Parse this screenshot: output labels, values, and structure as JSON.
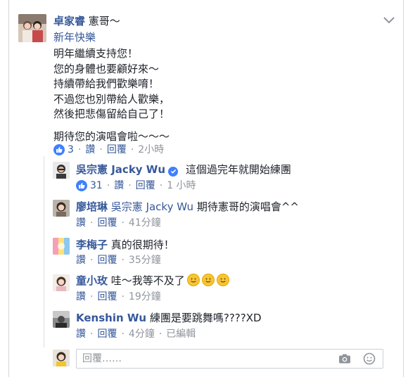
{
  "main_comment": {
    "author": "卓家睿",
    "mention": "憲哥～",
    "tag": "新年快樂",
    "lines": [
      "明年繼續支持您！",
      "您的身體也要顧好來～",
      "持續帶給我們歡樂唷！",
      "不過您也別帶給人歡樂，",
      "然後把悲傷留給自己了！",
      "期待您的演唱會啦～～～"
    ],
    "like_count": "3",
    "like_label": "讚",
    "reply_label": "回覆",
    "time": "2小時"
  },
  "replies": [
    {
      "author": "吳宗憲 Jacky Wu",
      "text": "這個過完年就開始練團",
      "like_count": "31",
      "like_label": "讚",
      "reply_label": "回覆",
      "time": "1 小時",
      "verified": true
    },
    {
      "author": "廖培琳",
      "mention": "吳宗憲 Jacky Wu",
      "text": "期待憲哥的演唱會^^",
      "like_label": "讚",
      "reply_label": "回覆",
      "time": "41分鐘"
    },
    {
      "author": "李梅子",
      "text": "真的很期待！",
      "like_label": "讚",
      "reply_label": "回覆",
      "time": "35分鐘"
    },
    {
      "author": "童小玫",
      "text": "哇～我等不及了",
      "like_label": "讚",
      "reply_label": "回覆",
      "time": "19分鐘"
    },
    {
      "author": "Kenshin Wu",
      "text": "練團是要跳舞嗎????XD",
      "like_label": "讚",
      "reply_label": "回覆",
      "time": "4分鐘",
      "edited": "已編輯"
    }
  ],
  "composer": {
    "placeholder": "回覆……"
  },
  "icons": {
    "like": "thumbs-up-icon",
    "verified": "verified-badge-icon",
    "camera": "camera-icon",
    "emoji": "smiley-icon",
    "menu": "chevron-down-icon"
  },
  "colors": {
    "link": "#365899",
    "meta": "#90949c",
    "like_blue": "#4080ff"
  }
}
